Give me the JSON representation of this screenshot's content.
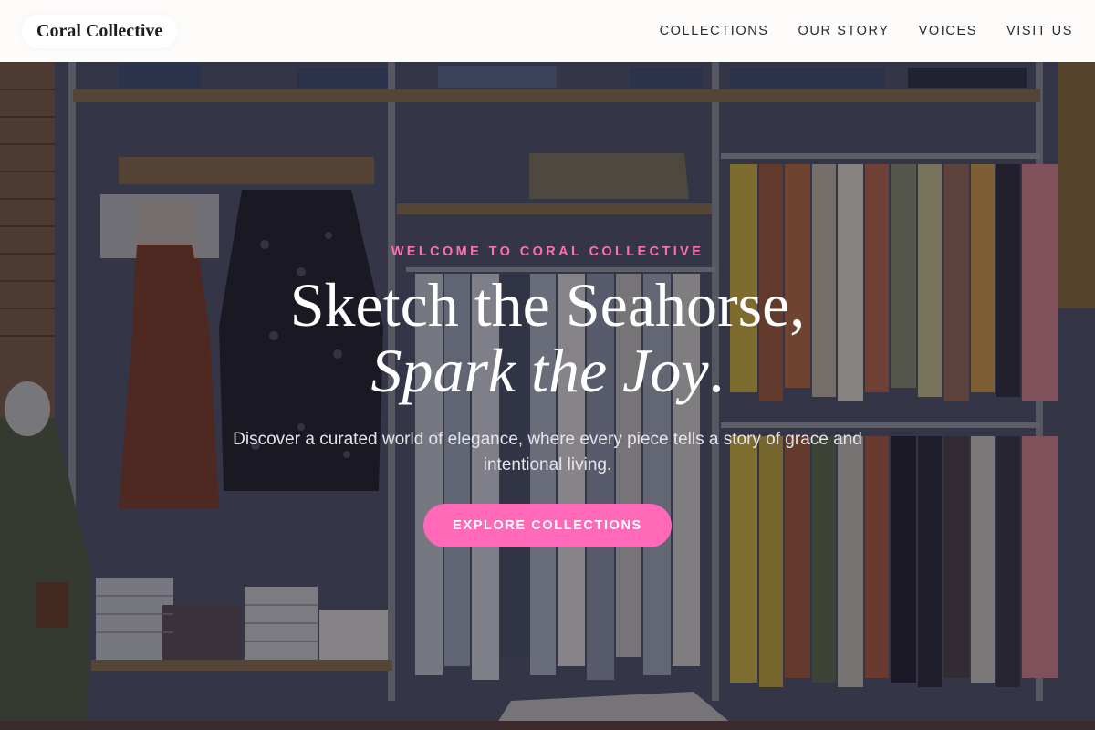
{
  "header": {
    "brand": "Coral Collective",
    "nav": [
      {
        "label": "COLLECTIONS"
      },
      {
        "label": "OUR STORY"
      },
      {
        "label": "VOICES"
      },
      {
        "label": "VISIT US"
      }
    ]
  },
  "hero": {
    "eyebrow": "WELCOME TO CORAL COLLECTIVE",
    "headline_line1": "Sketch the Seahorse,",
    "headline_line2": "Spark the Joy",
    "headline_period": ".",
    "subtext": "Discover a curated world of elegance, where every piece tells a story of grace and intentional living.",
    "cta_label": "EXPLORE COLLECTIONS"
  },
  "colors": {
    "accent": "#ff69b8",
    "eyebrow": "#ff6fb7",
    "header_bg": "#fdfcfb",
    "overlay": "#141422"
  },
  "icons": {
    "background": "clothing-store-photo"
  }
}
